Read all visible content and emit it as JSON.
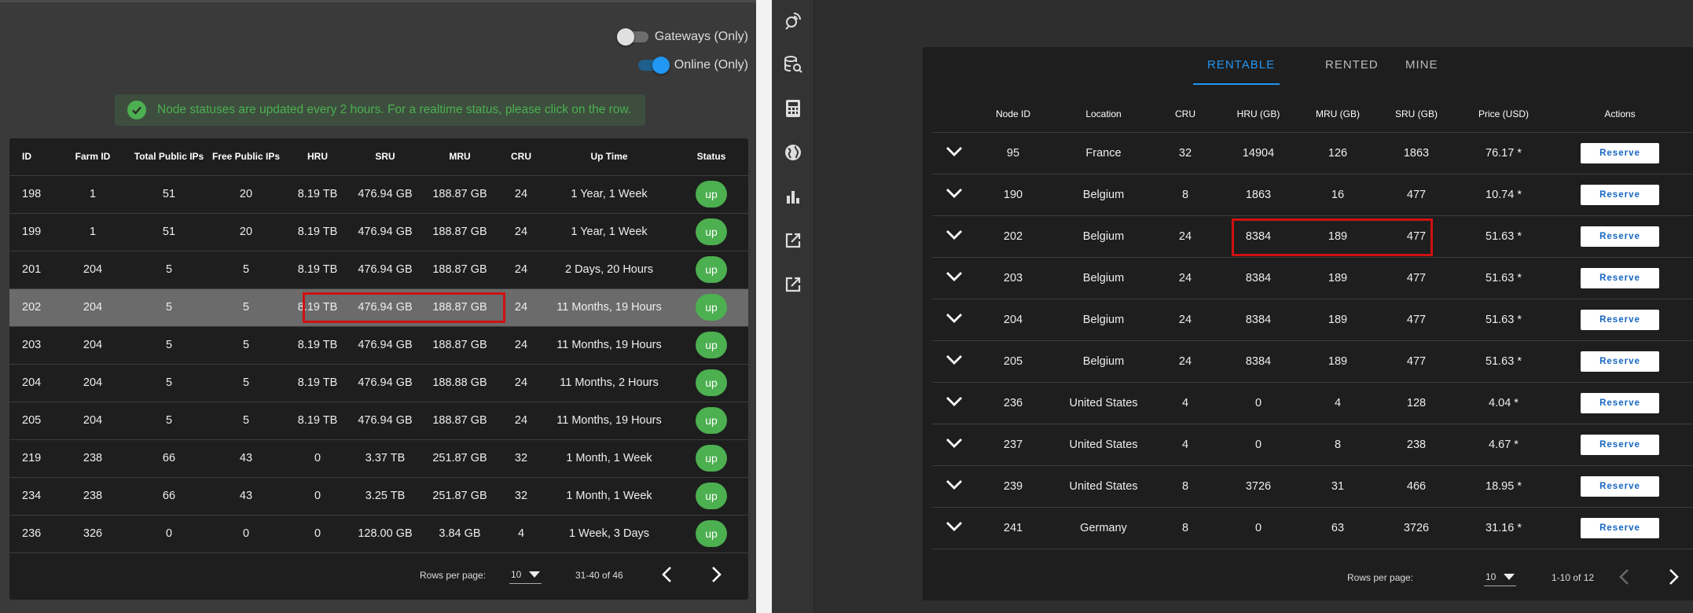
{
  "filters": {
    "gateways": {
      "label": "Gateways (Only)",
      "on": false
    },
    "online": {
      "label": "Online (Only)",
      "on": true
    }
  },
  "alert": {
    "text": "Node statuses are updated every 2 hours. For a realtime status, please click on the row."
  },
  "nodes_table": {
    "headers": [
      "ID",
      "Farm ID",
      "Total Public IPs",
      "Free Public IPs",
      "HRU",
      "SRU",
      "MRU",
      "CRU",
      "Up Time",
      "Status"
    ],
    "rows": [
      [
        "198",
        "1",
        "51",
        "20",
        "8.19 TB",
        "476.94 GB",
        "188.87 GB",
        "24",
        "1 Year, 1 Week",
        "up"
      ],
      [
        "199",
        "1",
        "51",
        "20",
        "8.19 TB",
        "476.94 GB",
        "188.87 GB",
        "24",
        "1 Year, 1 Week",
        "up"
      ],
      [
        "201",
        "204",
        "5",
        "5",
        "8.19 TB",
        "476.94 GB",
        "188.87 GB",
        "24",
        "2 Days, 20 Hours",
        "up"
      ],
      [
        "202",
        "204",
        "5",
        "5",
        "8.19 TB",
        "476.94 GB",
        "188.87 GB",
        "24",
        "11 Months, 19 Hours",
        "up"
      ],
      [
        "203",
        "204",
        "5",
        "5",
        "8.19 TB",
        "476.94 GB",
        "188.87 GB",
        "24",
        "11 Months, 19 Hours",
        "up"
      ],
      [
        "204",
        "204",
        "5",
        "5",
        "8.19 TB",
        "476.94 GB",
        "188.88 GB",
        "24",
        "11 Months, 2 Hours",
        "up"
      ],
      [
        "205",
        "204",
        "5",
        "5",
        "8.19 TB",
        "476.94 GB",
        "188.87 GB",
        "24",
        "11 Months, 19 Hours",
        "up"
      ],
      [
        "219",
        "238",
        "66",
        "43",
        "0",
        "3.37 TB",
        "251.87 GB",
        "32",
        "1 Month, 1 Week",
        "up"
      ],
      [
        "234",
        "238",
        "66",
        "43",
        "0",
        "3.25 TB",
        "251.87 GB",
        "32",
        "1 Month, 1 Week",
        "up"
      ],
      [
        "236",
        "326",
        "0",
        "0",
        "0",
        "128.00 GB",
        "3.84 GB",
        "4",
        "1 Week, 3 Days",
        "up"
      ]
    ],
    "selected_row_id": "202",
    "footer": {
      "rows_per_page_label": "Rows per page:",
      "rows_per_page": "10",
      "range": "31-40 of 46"
    }
  },
  "sidebar": {
    "icons": [
      "satellite-icon",
      "storage-search-icon",
      "calculator-icon",
      "globe-icon",
      "bar-chart-icon",
      "external-link-icon",
      "external-link-icon"
    ]
  },
  "rentable": {
    "tabs": [
      {
        "label": "RENTABLE",
        "active": true
      },
      {
        "label": "RENTED",
        "active": false
      },
      {
        "label": "MINE",
        "active": false
      }
    ],
    "headers": [
      "",
      "Node ID",
      "Location",
      "CRU",
      "HRU (GB)",
      "MRU (GB)",
      "SRU (GB)",
      "Price (USD)",
      "Actions"
    ],
    "reserve_label": "Reserve",
    "rows": [
      [
        "95",
        "France",
        "32",
        "14904",
        "126",
        "1863",
        "76.17 *"
      ],
      [
        "190",
        "Belgium",
        "8",
        "1863",
        "16",
        "477",
        "10.74 *"
      ],
      [
        "202",
        "Belgium",
        "24",
        "8384",
        "189",
        "477",
        "51.63 *"
      ],
      [
        "203",
        "Belgium",
        "24",
        "8384",
        "189",
        "477",
        "51.63 *"
      ],
      [
        "204",
        "Belgium",
        "24",
        "8384",
        "189",
        "477",
        "51.63 *"
      ],
      [
        "205",
        "Belgium",
        "24",
        "8384",
        "189",
        "477",
        "51.63 *"
      ],
      [
        "236",
        "United States",
        "4",
        "0",
        "4",
        "128",
        "4.04 *"
      ],
      [
        "237",
        "United States",
        "4",
        "0",
        "8",
        "238",
        "4.67 *"
      ],
      [
        "239",
        "United States",
        "8",
        "3726",
        "31",
        "466",
        "18.95 *"
      ],
      [
        "241",
        "Germany",
        "8",
        "0",
        "63",
        "3726",
        "31.16 *"
      ]
    ],
    "footer": {
      "rows_per_page_label": "Rows per page:",
      "rows_per_page": "10",
      "range": "1-10 of 12"
    }
  },
  "colors": {
    "accent": "#2196f3",
    "success": "#4caf50",
    "highlight": "#d01010"
  }
}
